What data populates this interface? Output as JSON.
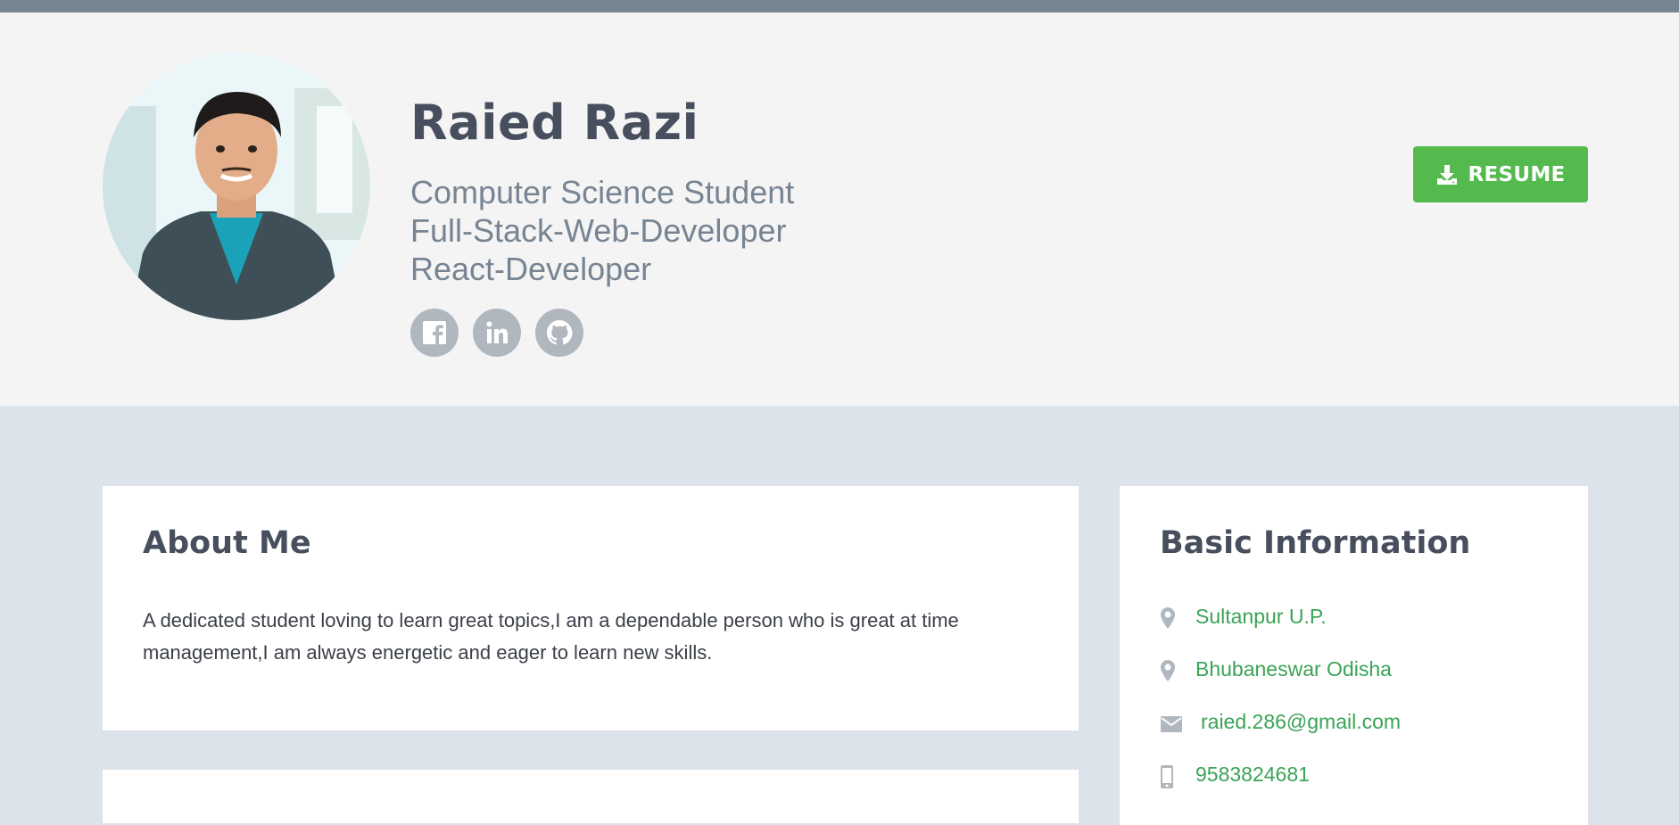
{
  "profile": {
    "name": "Raied Razi",
    "taglines": [
      "Computer Science Student",
      "Full-Stack-Web-Developer",
      "React-Developer"
    ],
    "social": [
      "facebook-icon",
      "linkedin-icon",
      "github-icon"
    ]
  },
  "resume_button": {
    "label": "RESUME",
    "icon": "download-icon",
    "color": "#54ba4e"
  },
  "about": {
    "title": "About Me",
    "text": "A dedicated student loving to learn great topics,I am a dependable person who is great at time management,I am always energetic and eager to learn new skills."
  },
  "basic_info": {
    "title": "Basic Information",
    "items": [
      {
        "icon": "map-marker-icon",
        "text": "Sultanpur U.P."
      },
      {
        "icon": "map-marker-icon",
        "text": "Bhubaneswar Odisha"
      },
      {
        "icon": "envelope-icon",
        "text": "raied.286@gmail.com"
      },
      {
        "icon": "mobile-phone-icon",
        "text": "9583824681"
      }
    ]
  },
  "colors": {
    "topbar": "#778492",
    "header_bg": "#f4f4f4",
    "page_bg": "#dce3ea",
    "link": "#3aa356",
    "heading": "#474e5d"
  }
}
